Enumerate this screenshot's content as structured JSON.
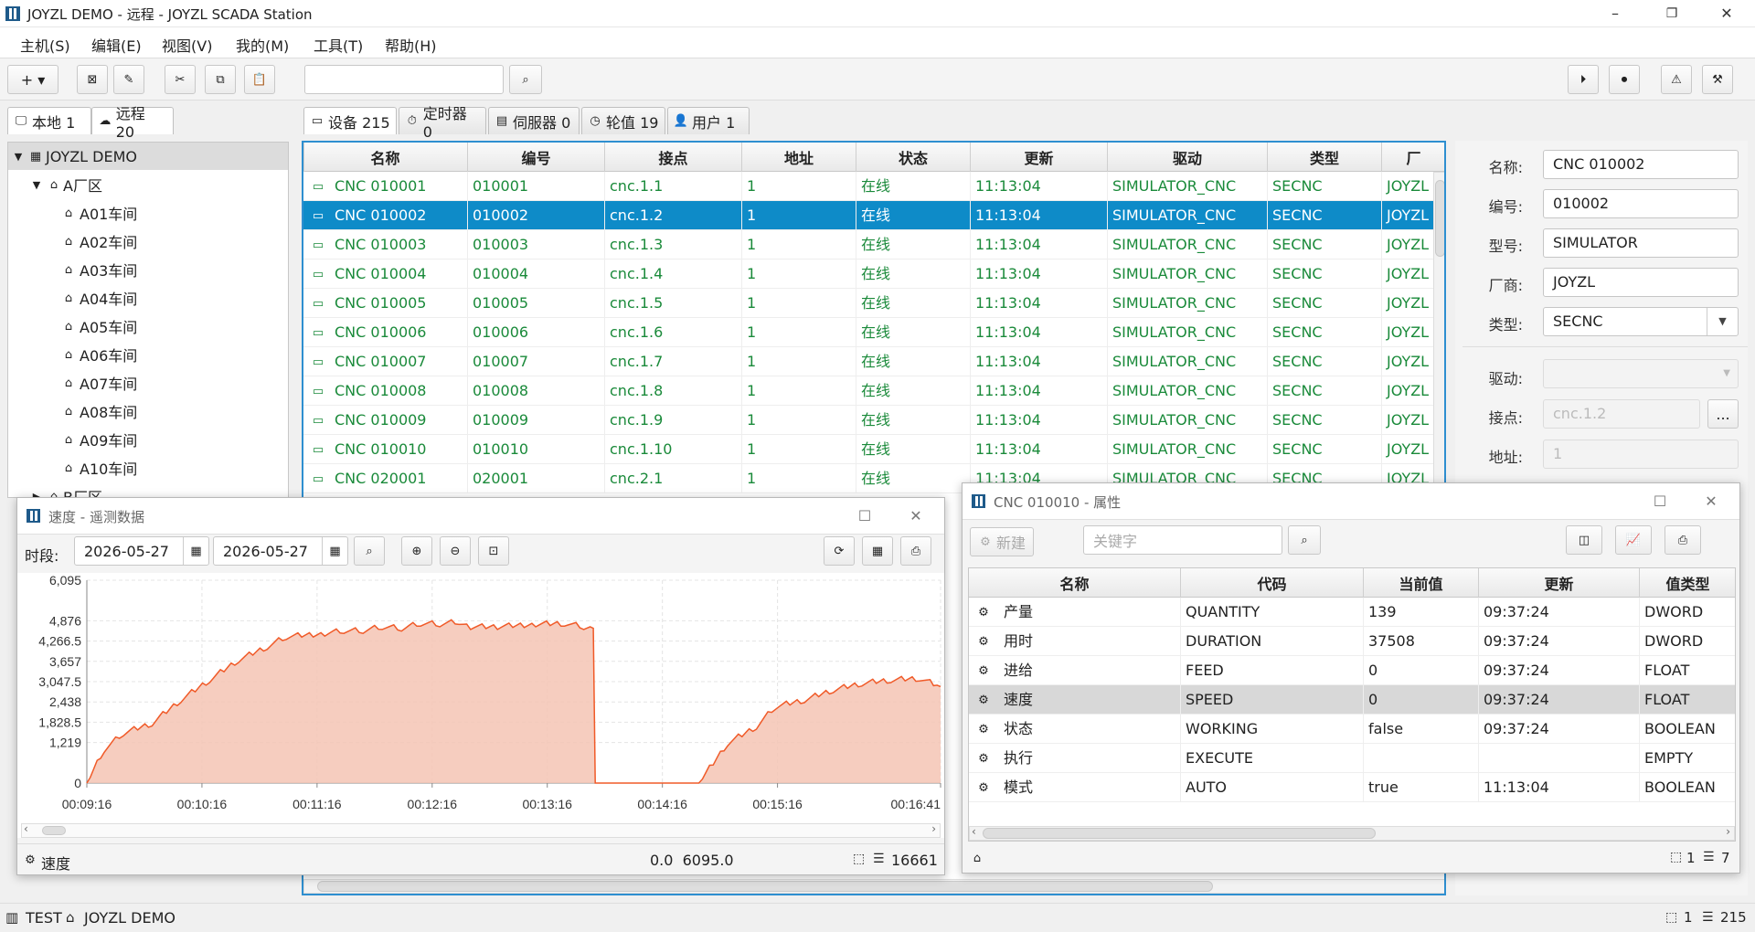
{
  "app": {
    "title": "JOYZL DEMO - 远程 - JOYZL SCADA Station",
    "win_min": "–",
    "win_max": "❐",
    "win_close": "✕"
  },
  "menu": [
    "主机(S)",
    "编辑(E)",
    "视图(V)",
    "我的(M)",
    "工具(T)",
    "帮助(H)"
  ],
  "toolbar": {
    "add": "+ ▾",
    "search_value": "",
    "icons": [
      "add-icon",
      "delete-icon",
      "edit-icon",
      "cut-icon",
      "copy-icon",
      "paste-icon",
      "search-icon",
      "play-icon",
      "stop-icon",
      "alarm-icon",
      "tools-icon"
    ]
  },
  "left_tabs": [
    {
      "label": "本地 1",
      "icon": "monitor-icon"
    },
    {
      "label": "远程 20",
      "icon": "cloud-icon"
    }
  ],
  "tree": {
    "root": "JOYZL DEMO",
    "area": "A厂区",
    "workshops": [
      "A01车间",
      "A02车间",
      "A03车间",
      "A04车间",
      "A05车间",
      "A06车间",
      "A07车间",
      "A08车间",
      "A09车间",
      "A10车间"
    ],
    "area_b": "B厂区"
  },
  "main_tabs": [
    {
      "label": "设备 215",
      "icon": "device-icon"
    },
    {
      "label": "定时器 0",
      "icon": "timer-icon"
    },
    {
      "label": "伺服器 0",
      "icon": "server-icon"
    },
    {
      "label": "轮值 19",
      "icon": "clock-icon"
    },
    {
      "label": "用户 1",
      "icon": "user-icon"
    }
  ],
  "device_table": {
    "columns": [
      "名称",
      "编号",
      "接点",
      "地址",
      "状态",
      "更新",
      "驱动",
      "类型",
      "厂"
    ],
    "rows": [
      [
        "CNC 010001",
        "010001",
        "cnc.1.1",
        "1",
        "在线",
        "11:13:04",
        "SIMULATOR_CNC",
        "SECNC",
        "JOYZL"
      ],
      [
        "CNC 010002",
        "010002",
        "cnc.1.2",
        "1",
        "在线",
        "11:13:04",
        "SIMULATOR_CNC",
        "SECNC",
        "JOYZL"
      ],
      [
        "CNC 010003",
        "010003",
        "cnc.1.3",
        "1",
        "在线",
        "11:13:04",
        "SIMULATOR_CNC",
        "SECNC",
        "JOYZL"
      ],
      [
        "CNC 010004",
        "010004",
        "cnc.1.4",
        "1",
        "在线",
        "11:13:04",
        "SIMULATOR_CNC",
        "SECNC",
        "JOYZL"
      ],
      [
        "CNC 010005",
        "010005",
        "cnc.1.5",
        "1",
        "在线",
        "11:13:04",
        "SIMULATOR_CNC",
        "SECNC",
        "JOYZL"
      ],
      [
        "CNC 010006",
        "010006",
        "cnc.1.6",
        "1",
        "在线",
        "11:13:04",
        "SIMULATOR_CNC",
        "SECNC",
        "JOYZL"
      ],
      [
        "CNC 010007",
        "010007",
        "cnc.1.7",
        "1",
        "在线",
        "11:13:04",
        "SIMULATOR_CNC",
        "SECNC",
        "JOYZL"
      ],
      [
        "CNC 010008",
        "010008",
        "cnc.1.8",
        "1",
        "在线",
        "11:13:04",
        "SIMULATOR_CNC",
        "SECNC",
        "JOYZL"
      ],
      [
        "CNC 010009",
        "010009",
        "cnc.1.9",
        "1",
        "在线",
        "11:13:04",
        "SIMULATOR_CNC",
        "SECNC",
        "JOYZL"
      ],
      [
        "CNC 010010",
        "010010",
        "cnc.1.10",
        "1",
        "在线",
        "11:13:04",
        "SIMULATOR_CNC",
        "SECNC",
        "JOYZL"
      ],
      [
        "CNC 020001",
        "020001",
        "cnc.2.1",
        "1",
        "在线",
        "11:13:04",
        "SIMULATOR_CNC",
        "SECNC",
        "JOYZL"
      ]
    ],
    "selected_row": 1,
    "row_color": "#1a8a3a",
    "selected_bg": "#0e8bc8"
  },
  "props": {
    "name_label": "名称:",
    "name": "CNC 010002",
    "code_label": "编号:",
    "code": "010002",
    "model_label": "型号:",
    "model": "SIMULATOR",
    "vendor_label": "厂商:",
    "vendor": "JOYZL",
    "type_label": "类型:",
    "type": "SECNC",
    "driver_label": "驱动:",
    "driver": "",
    "node_label": "接点:",
    "node": "cnc.1.2",
    "node_btn": "...",
    "addr_label": "地址:",
    "addr": "1"
  },
  "chart_window": {
    "title": "速度 - 遥测数据",
    "period_label": "时段:",
    "date_from": "2026-05-27",
    "date_to": "2026-05-27",
    "footer_name": "速度",
    "footer_range": "0.0  6095.0",
    "footer_count": "16661"
  },
  "chart_data": {
    "type": "area",
    "title": "",
    "xlabel": "",
    "ylabel": "",
    "x_ticks": [
      "00:09:16",
      "00:10:16",
      "00:11:16",
      "00:12:16",
      "00:13:16",
      "00:14:16",
      "00:15:16",
      "00:16:41"
    ],
    "y_ticks": [
      0,
      1219,
      1828.5,
      2438,
      3047.5,
      3657,
      4266.5,
      4876,
      6095
    ],
    "y_tick_labels": [
      "0",
      "1,219",
      "1,828.5",
      "2,438",
      "3,047.5",
      "3,657",
      "4,266.5",
      "4,876",
      "6,095"
    ],
    "ylim": [
      0,
      6095
    ],
    "x_range_sec": [
      556,
      1001
    ],
    "color": "#f05a28",
    "fill": "#f5c4b4",
    "grid": true,
    "points": [
      [
        556,
        0
      ],
      [
        565,
        1000
      ],
      [
        575,
        1500
      ],
      [
        590,
        1800
      ],
      [
        605,
        2500
      ],
      [
        620,
        3100
      ],
      [
        635,
        3700
      ],
      [
        650,
        4100
      ],
      [
        660,
        4400
      ],
      [
        680,
        4500
      ],
      [
        690,
        4580
      ],
      [
        700,
        4580
      ],
      [
        710,
        4700
      ],
      [
        720,
        4650
      ],
      [
        730,
        4800
      ],
      [
        740,
        4780
      ],
      [
        750,
        4850
      ],
      [
        756,
        4700
      ],
      [
        770,
        4700
      ],
      [
        790,
        4780
      ],
      [
        805,
        4800
      ],
      [
        815,
        4700
      ],
      [
        820,
        4650
      ],
      [
        821,
        0
      ],
      [
        851,
        0
      ],
      [
        875,
        0
      ],
      [
        890,
        1200
      ],
      [
        905,
        1700
      ],
      [
        915,
        2300
      ],
      [
        930,
        2500
      ],
      [
        945,
        2800
      ],
      [
        960,
        3000
      ],
      [
        975,
        3100
      ],
      [
        990,
        3150
      ],
      [
        1001,
        2900
      ]
    ]
  },
  "attr_window": {
    "title": "CNC 010010 - 属性",
    "new_label": "新建",
    "search_placeholder": "关键字",
    "columns": [
      "名称",
      "代码",
      "当前值",
      "更新",
      "值类型"
    ],
    "rows": [
      [
        "产量",
        "QUANTITY",
        "139",
        "09:37:24",
        "DWORD"
      ],
      [
        "用时",
        "DURATION",
        "37508",
        "09:37:24",
        "DWORD"
      ],
      [
        "进给",
        "FEED",
        "0",
        "09:37:24",
        "FLOAT"
      ],
      [
        "速度",
        "SPEED",
        "0",
        "09:37:24",
        "FLOAT"
      ],
      [
        "状态",
        "WORKING",
        "false",
        "09:37:24",
        "BOOLEAN"
      ],
      [
        "执行",
        "EXECUTE",
        "",
        "",
        "EMPTY"
      ],
      [
        "模式",
        "AUTO",
        "true",
        "11:13:04",
        "BOOLEAN"
      ]
    ],
    "selected_row": 3,
    "footer_sel": "1",
    "footer_total": "7"
  },
  "status_bar": {
    "host": "TEST",
    "station": "JOYZL DEMO",
    "sel": "1",
    "total": "215"
  }
}
